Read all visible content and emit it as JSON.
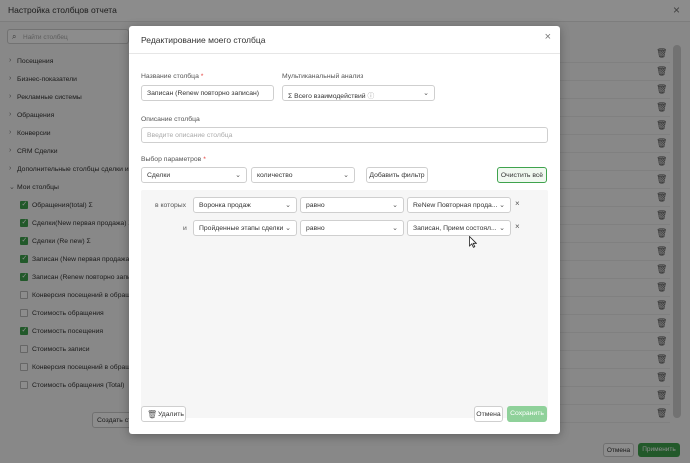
{
  "background": {
    "title": "Настройка столбцов отчета",
    "search_placeholder": "Найти столбец",
    "groups": [
      {
        "label": "Посещения"
      },
      {
        "label": "Бизнес-показатели"
      },
      {
        "label": "Рекламные системы"
      },
      {
        "label": "Обращения"
      },
      {
        "label": "Конверсии"
      },
      {
        "label": "CRM Сделки"
      },
      {
        "label": "Дополнительные столбцы сделки и"
      }
    ],
    "my_columns": {
      "label": "Мои столбцы",
      "items": [
        {
          "label": "Обращения(total) Σ",
          "checked": true
        },
        {
          "label": "Сделки(New первая продажа) Σ",
          "checked": true
        },
        {
          "label": "Сделки (Re new) Σ",
          "checked": true
        },
        {
          "label": "Записан (New первая продажа)",
          "checked": true
        },
        {
          "label": "Записан (Renew повторно запи",
          "checked": true
        },
        {
          "label": "Конверсия посещений в обраще",
          "checked": false
        },
        {
          "label": "Стоимость обращения",
          "checked": false
        },
        {
          "label": "Стоимость посещения",
          "checked": true
        },
        {
          "label": "Стоимость записи",
          "checked": false
        },
        {
          "label": "Конверсия посещений в обраще",
          "checked": false
        },
        {
          "label": "Стоимость обращения (Total)",
          "checked": false
        }
      ]
    },
    "create_label": "Создать ст",
    "cancel_label": "Отмена",
    "apply_label": "Применить"
  },
  "modal": {
    "title": "Редактирование моего столбца",
    "name_label": "Название столбца",
    "name_value": "Записан (Renew повторно записан)",
    "multichannel_label": "Мультиканальный анализ",
    "multichannel_value": "Σ Всего взаимодействий",
    "description_label": "Описание столбца",
    "description_placeholder": "Введите описание столбца",
    "params_label": "Выбор параметров",
    "param_entity": "Сделки",
    "param_metric": "количество",
    "add_filter_label": "Добавить фильтр",
    "clear_all_label": "Очистить всё",
    "filters": [
      {
        "prefix": "в которых",
        "field": "Воронка продаж",
        "operator": "равно",
        "value": "ReNew Повторная прода..."
      },
      {
        "prefix": "и",
        "field": "Пройденные этапы сделки",
        "operator": "равно",
        "value": "Записан, Прием состоял..."
      }
    ],
    "delete_label": "Удалить",
    "cancel_label": "Отмена",
    "save_label": "Сохранить"
  },
  "colors": {
    "accent": "#3fa34d",
    "save_disabled": "#8fd19a",
    "required": "#e53935"
  }
}
